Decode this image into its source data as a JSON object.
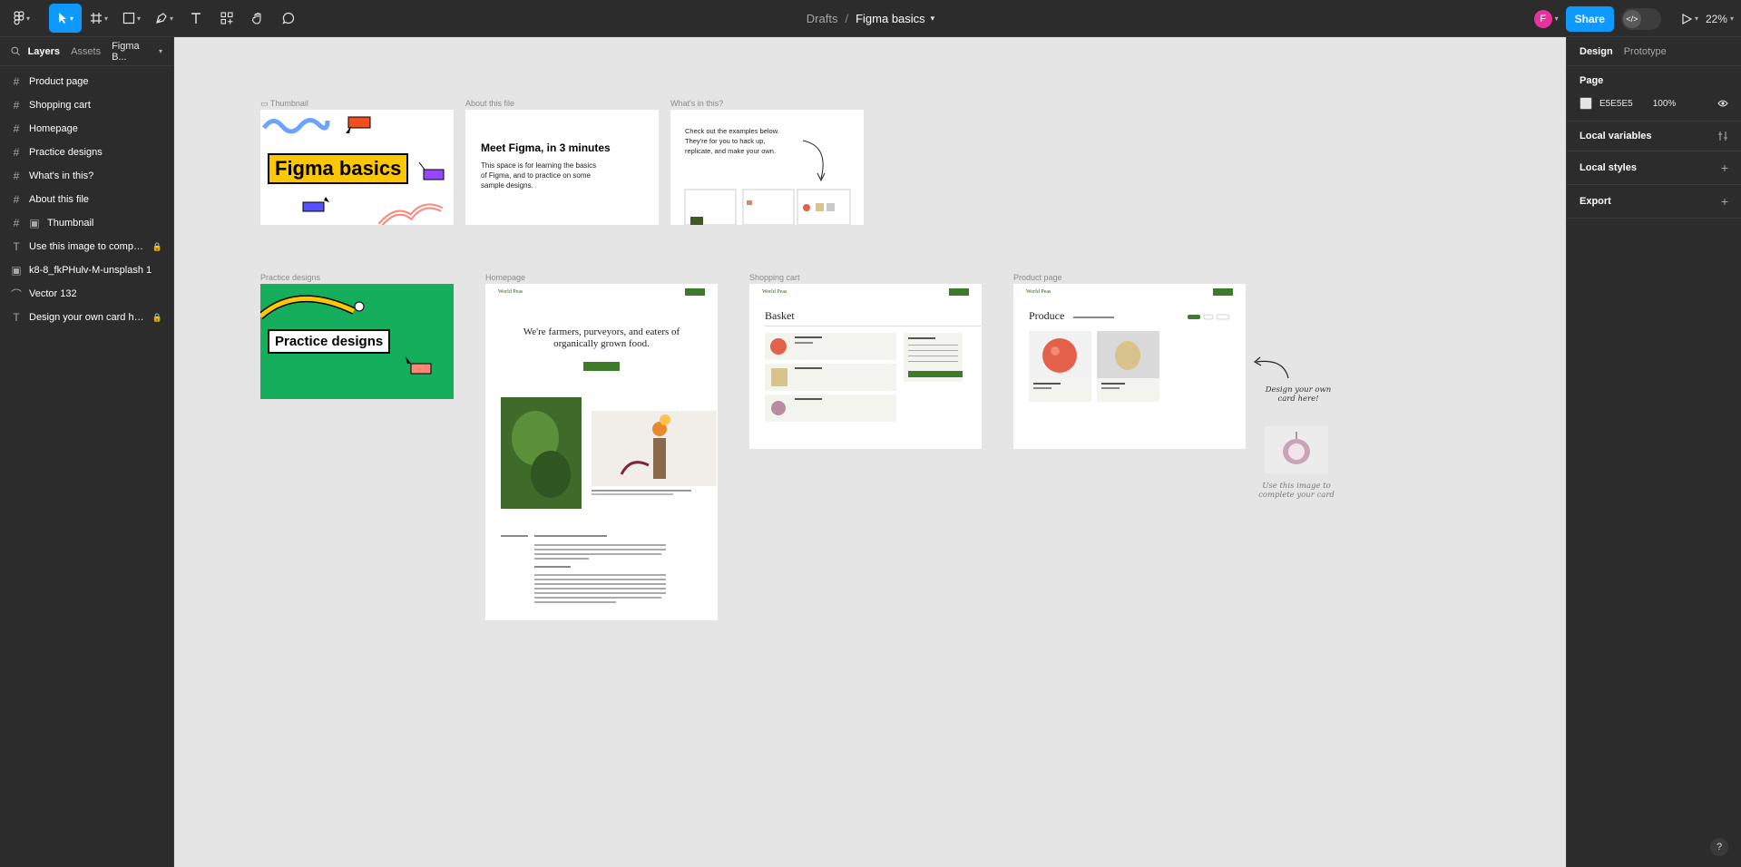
{
  "toolbar": {
    "breadcrumb_parent": "Drafts",
    "breadcrumb_sep": "/",
    "file_title": "Figma basics",
    "avatar_initial": "F",
    "share_label": "Share",
    "zoom_label": "22%"
  },
  "left_panel": {
    "tabs": [
      "Layers",
      "Assets"
    ],
    "page_selector": "Figma B...",
    "layers": [
      {
        "icon": "frame-icon",
        "label": "Product page"
      },
      {
        "icon": "frame-icon",
        "label": "Shopping cart"
      },
      {
        "icon": "frame-icon",
        "label": "Homepage"
      },
      {
        "icon": "frame-icon",
        "label": "Practice designs"
      },
      {
        "icon": "frame-icon",
        "label": "What's in this?"
      },
      {
        "icon": "frame-icon",
        "label": "About this file"
      },
      {
        "icon": "frame-icon",
        "label": "Thumbnail"
      },
      {
        "icon": "text-icon",
        "label": "Use this image to comple..."
      },
      {
        "icon": "image-icon",
        "label": "k8-8_fkPHulv-M-unsplash 1"
      },
      {
        "icon": "vector-icon",
        "label": "Vector 132"
      },
      {
        "icon": "text-icon",
        "label": "Design your own card here!"
      }
    ]
  },
  "right_panel": {
    "tabs": [
      "Design",
      "Prototype"
    ],
    "page_heading": "Page",
    "page_color": "E5E5E5",
    "page_opacity": "100%",
    "local_variables": "Local variables",
    "local_styles": "Local styles",
    "export": "Export",
    "help": "?"
  },
  "canvas": {
    "labels": {
      "thumbnail": "Thumbnail",
      "about": "About this file",
      "whats": "What's in this?",
      "practice": "Practice designs",
      "homepage": "Homepage",
      "cart": "Shopping cart",
      "product": "Product page"
    },
    "thumbnail_title": "Figma basics",
    "about_heading": "Meet Figma, in 3 minutes",
    "about_body": "This space is for learning the basics of Figma, and to practice on some sample designs.",
    "whats_body": "Check out the examples below. They're for you to hack up, replicate, and make your own.",
    "practice_title": "Practice designs",
    "brand": "World Peas",
    "hero_line1": "We're farmers, purveyors, and eaters of",
    "hero_line2": "organically grown food.",
    "basket_heading": "Basket",
    "produce_heading": "Produce",
    "card_hint": "Design your own card here!",
    "image_hint": "Use this image to complete your card"
  },
  "colors": {
    "accent": "#0d99ff",
    "canvas_bg": "#e5e5e5",
    "panel_bg": "#2c2c2c",
    "brand_green": "#3d7a2a",
    "thumbnail_yellow": "#ffc700",
    "practice_green": "#14ae5c"
  }
}
